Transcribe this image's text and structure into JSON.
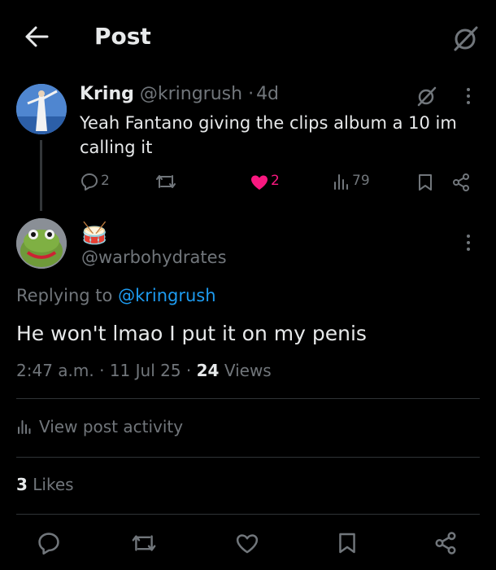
{
  "header": {
    "title": "Post"
  },
  "parent_post": {
    "display_name": "Kring",
    "handle": "@kringrush",
    "time": "4d",
    "text_line1": "Yeah Fantano giving the clips album a 10 im",
    "text_line2": "calling it",
    "replies": "2",
    "likes": "2",
    "views": "79"
  },
  "reply_post": {
    "display_name_emoji": "🥁",
    "handle": "@warbohydrates",
    "replying_to_prefix": "Replying to",
    "replying_to_handle": "@kringrush",
    "text": "He won't lmao I put it on my penis",
    "time": "2:47 a.m.",
    "date": "11 Jul 25",
    "views_count": "24",
    "views_label": "Views",
    "activity_label": "View post activity",
    "likes_count": "3",
    "likes_label": "Likes"
  },
  "colors": {
    "link": "#1d9bf0",
    "like_active": "#f91880",
    "muted": "#71767b",
    "background": "#000000"
  },
  "icons": [
    "back-arrow-icon",
    "grok-icon",
    "more-icon",
    "reply-icon",
    "repost-icon",
    "like-icon",
    "views-icon",
    "bookmark-icon",
    "share-icon",
    "analytics-icon"
  ]
}
